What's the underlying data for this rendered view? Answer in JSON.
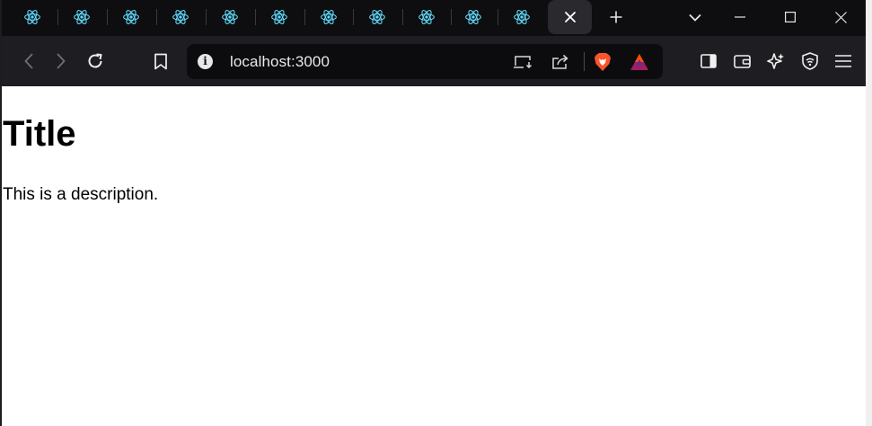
{
  "tabs": {
    "count": 12,
    "inactive_favicon": "react-atom-icon",
    "active_close_icon": "close-icon",
    "new_tab_icon": "plus-icon"
  },
  "window_controls": {
    "tab_search": "chevron-down-icon",
    "minimize": "minimize-icon",
    "maximize": "maximize-icon",
    "close": "close-icon"
  },
  "toolbar": {
    "back": "back-arrow-icon",
    "forward": "forward-arrow-icon",
    "reload": "reload-icon",
    "bookmark": "bookmark-icon",
    "url": "localhost:3000",
    "site_info": "i",
    "right_icons": [
      "sidebar-icon",
      "wallet-icon",
      "leo-ai-icon",
      "vpn-shield-icon",
      "menu-icon"
    ]
  },
  "page": {
    "title": "Title",
    "description": "This is a description."
  },
  "colors": {
    "tabstrip_bg": "#0e0e10",
    "toolbar_bg": "#1e1e22",
    "omnibox_bg": "#0c0c0e",
    "react_blue": "#61dafb",
    "brave_orange": "#fb542b"
  }
}
